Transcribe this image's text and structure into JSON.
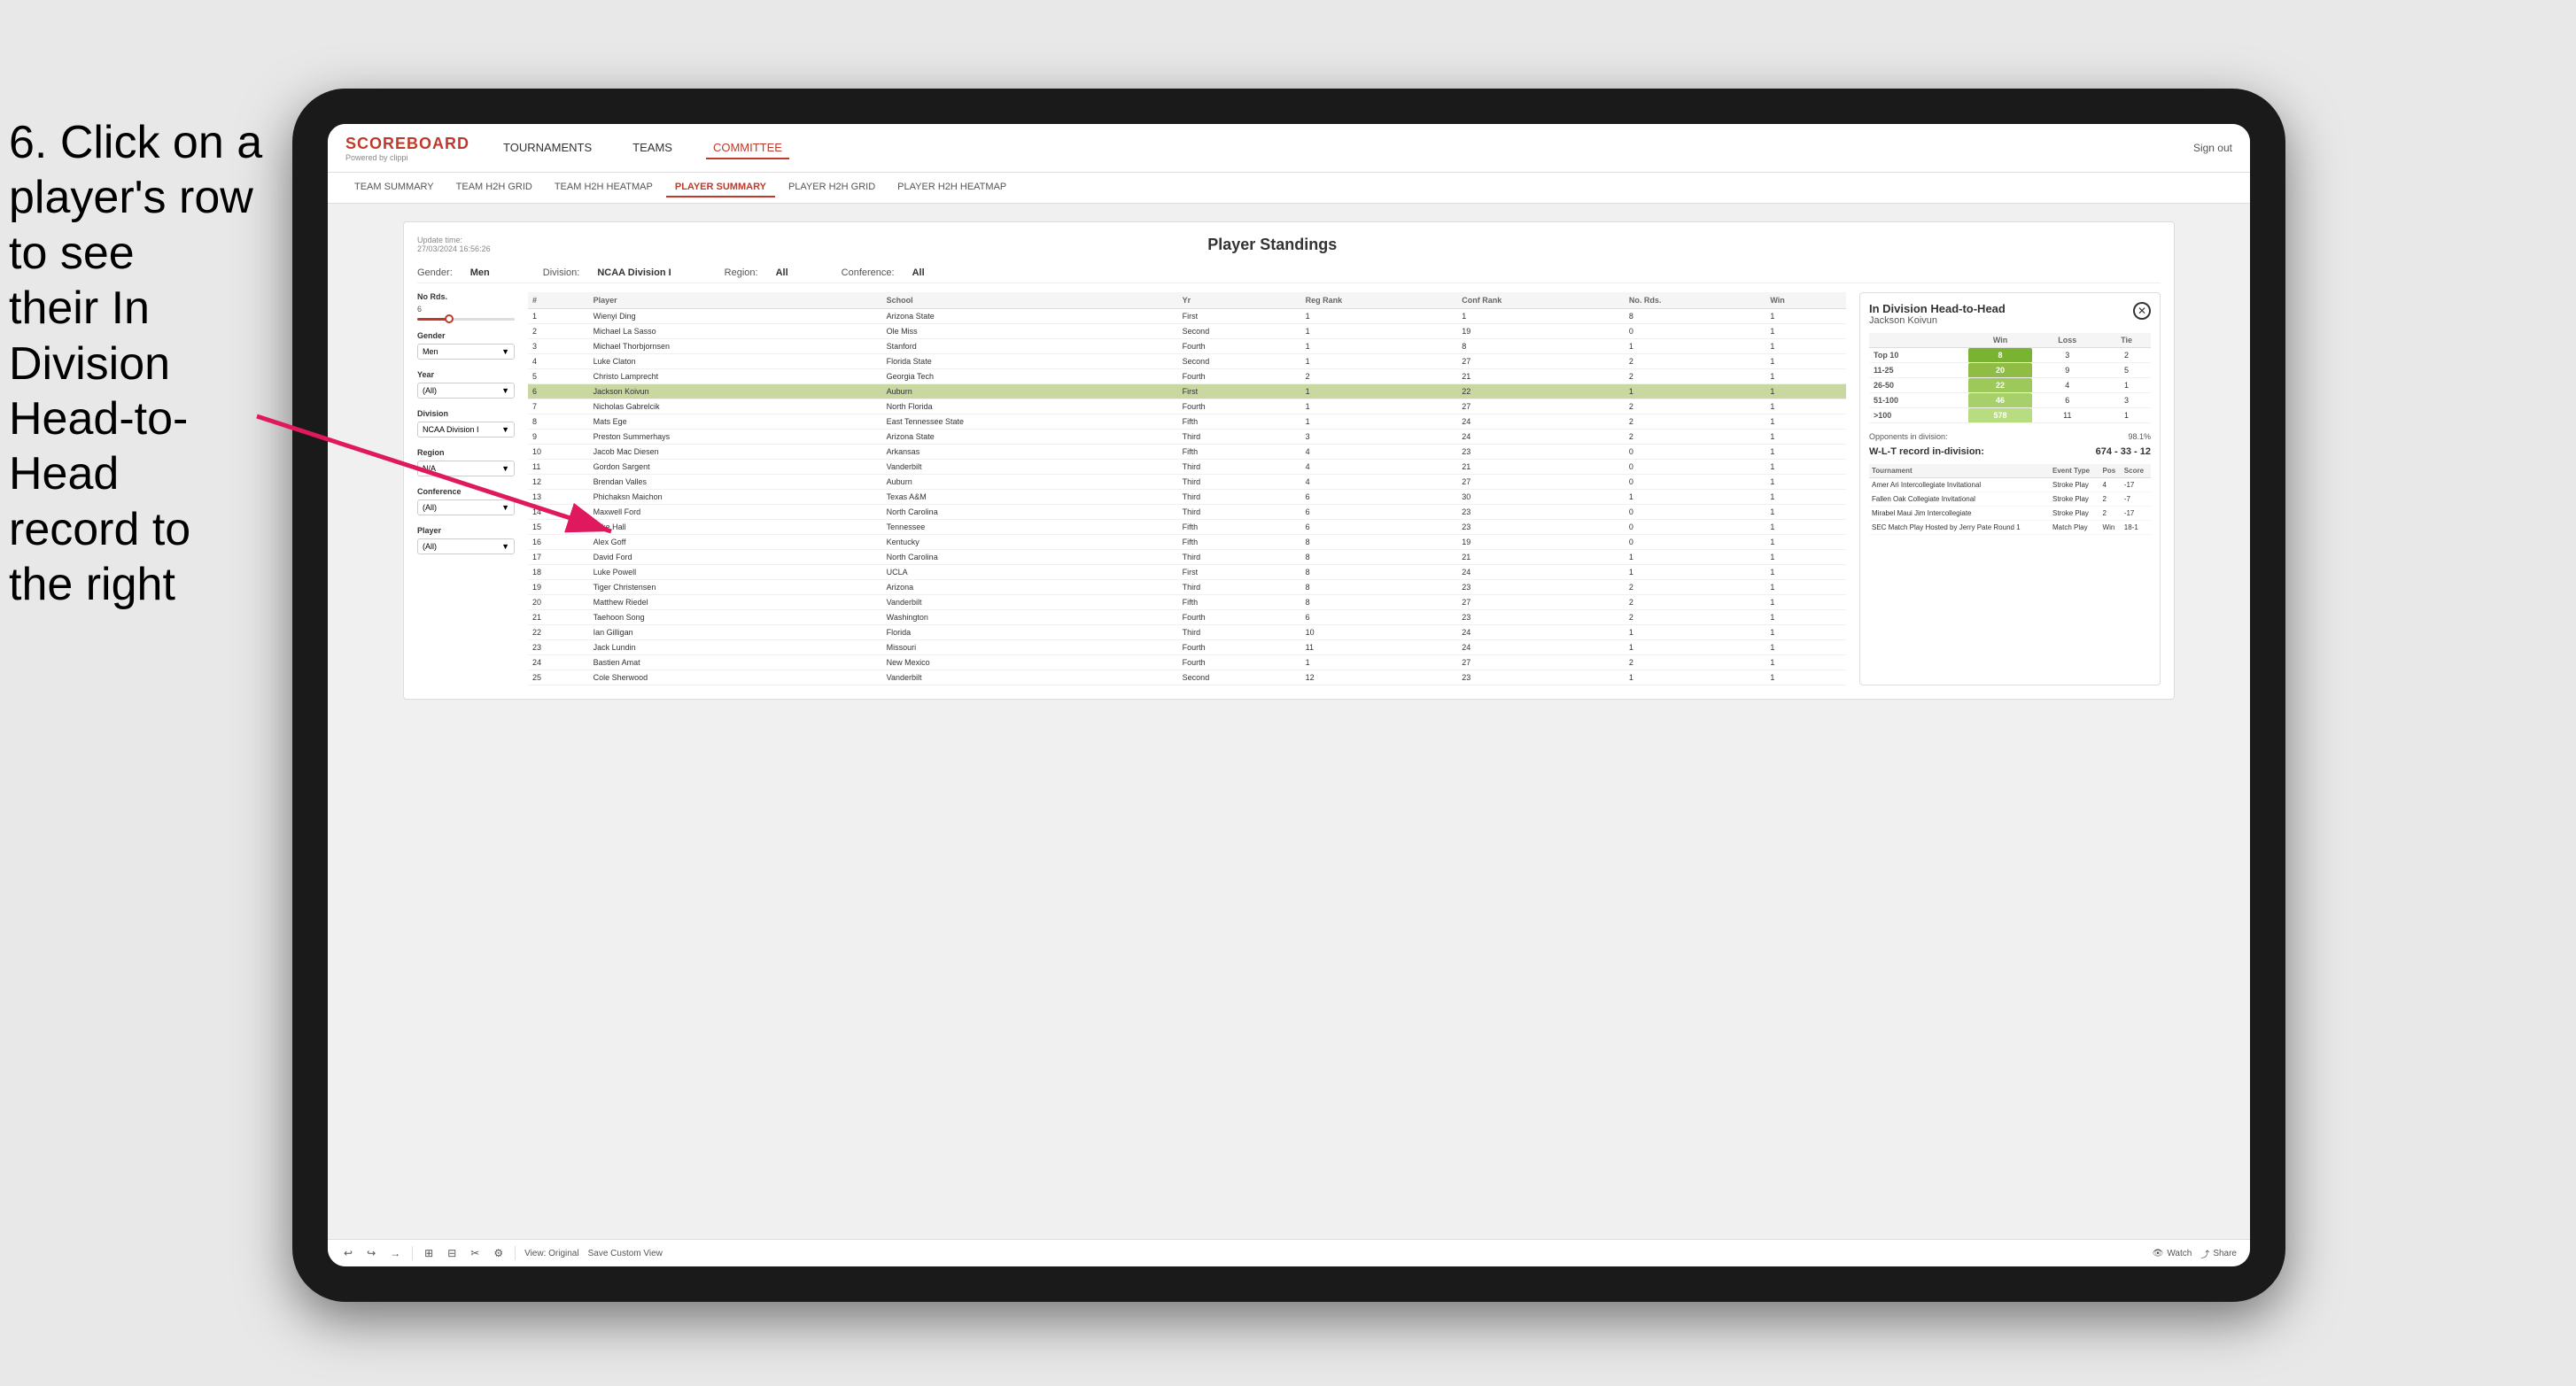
{
  "instruction": {
    "line1": "6. Click on a",
    "line2": "player's row to see",
    "line3": "their In Division",
    "line4": "Head-to-Head",
    "line5": "record to the right"
  },
  "nav": {
    "logo": "SCOREBOARD",
    "logo_sub": "Powered by clippi",
    "items": [
      "TOURNAMENTS",
      "TEAMS",
      "COMMITTEE"
    ],
    "sign_out": "Sign out"
  },
  "sub_nav": {
    "items": [
      "TEAM SUMMARY",
      "TEAM H2H GRID",
      "TEAM H2H HEATMAP",
      "PLAYER SUMMARY",
      "PLAYER H2H GRID",
      "PLAYER H2H HEATMAP"
    ]
  },
  "card": {
    "update_time": "Update time:",
    "update_date": "27/03/2024 16:56:26",
    "title": "Player Standings",
    "filters": {
      "gender_label": "Gender:",
      "gender_value": "Men",
      "division_label": "Division:",
      "division_value": "NCAA Division I",
      "region_label": "Region:",
      "region_value": "All",
      "conference_label": "Conference:",
      "conference_value": "All"
    }
  },
  "left_filters": {
    "no_rds": {
      "label": "No Rds.",
      "value": "6",
      "min_val": "6"
    },
    "gender": {
      "label": "Gender",
      "value": "Men"
    },
    "year": {
      "label": "Year",
      "value": "(All)"
    },
    "division": {
      "label": "Division",
      "value": "NCAA Division I"
    },
    "region": {
      "label": "Region",
      "value": "N/A"
    },
    "conference": {
      "label": "Conference",
      "value": "(All)"
    },
    "player": {
      "label": "Player",
      "value": "(All)"
    }
  },
  "table": {
    "headers": [
      "#",
      "Player",
      "School",
      "Yr",
      "Reg Rank",
      "Conf Rank",
      "No. Rds.",
      "Win"
    ],
    "rows": [
      {
        "num": 1,
        "player": "Wienyi Ding",
        "school": "Arizona State",
        "yr": "First",
        "reg_rank": 1,
        "conf_rank": 1,
        "no_rds": 8,
        "win": 1
      },
      {
        "num": 2,
        "player": "Michael La Sasso",
        "school": "Ole Miss",
        "yr": "Second",
        "reg_rank": 1,
        "conf_rank": 19,
        "no_rds": 0,
        "win": 1
      },
      {
        "num": 3,
        "player": "Michael Thorbjornsen",
        "school": "Stanford",
        "yr": "Fourth",
        "reg_rank": 1,
        "conf_rank": 8,
        "no_rds": 1,
        "win": 1
      },
      {
        "num": 4,
        "player": "Luke Claton",
        "school": "Florida State",
        "yr": "Second",
        "reg_rank": 1,
        "conf_rank": 27,
        "no_rds": 2,
        "win": 1
      },
      {
        "num": 5,
        "player": "Christo Lamprecht",
        "school": "Georgia Tech",
        "yr": "Fourth",
        "reg_rank": 2,
        "conf_rank": 21,
        "no_rds": 2,
        "win": 1
      },
      {
        "num": 6,
        "player": "Jackson Koivun",
        "school": "Auburn",
        "yr": "First",
        "reg_rank": 1,
        "conf_rank": 22,
        "no_rds": 1,
        "win": 1,
        "selected": true
      },
      {
        "num": 7,
        "player": "Nicholas Gabrelcik",
        "school": "North Florida",
        "yr": "Fourth",
        "reg_rank": 1,
        "conf_rank": 27,
        "no_rds": 2,
        "win": 1
      },
      {
        "num": 8,
        "player": "Mats Ege",
        "school": "East Tennessee State",
        "yr": "Fifth",
        "reg_rank": 1,
        "conf_rank": 24,
        "no_rds": 2,
        "win": 1
      },
      {
        "num": 9,
        "player": "Preston Summerhays",
        "school": "Arizona State",
        "yr": "Third",
        "reg_rank": 3,
        "conf_rank": 24,
        "no_rds": 2,
        "win": 1
      },
      {
        "num": 10,
        "player": "Jacob Mac Diesen",
        "school": "Arkansas",
        "yr": "Fifth",
        "reg_rank": 4,
        "conf_rank": 23,
        "no_rds": 0,
        "win": 1
      },
      {
        "num": 11,
        "player": "Gordon Sargent",
        "school": "Vanderbilt",
        "yr": "Third",
        "reg_rank": 4,
        "conf_rank": 21,
        "no_rds": 0,
        "win": 1
      },
      {
        "num": 12,
        "player": "Brendan Valles",
        "school": "Auburn",
        "yr": "Third",
        "reg_rank": 4,
        "conf_rank": 27,
        "no_rds": 0,
        "win": 1
      },
      {
        "num": 13,
        "player": "Phichaksn Maichon",
        "school": "Texas A&M",
        "yr": "Third",
        "reg_rank": 6,
        "conf_rank": 30,
        "no_rds": 1,
        "win": 1
      },
      {
        "num": 14,
        "player": "Maxwell Ford",
        "school": "North Carolina",
        "yr": "Third",
        "reg_rank": 6,
        "conf_rank": 23,
        "no_rds": 0,
        "win": 1
      },
      {
        "num": 15,
        "player": "Jake Hall",
        "school": "Tennessee",
        "yr": "Fifth",
        "reg_rank": 6,
        "conf_rank": 23,
        "no_rds": 0,
        "win": 1
      },
      {
        "num": 16,
        "player": "Alex Goff",
        "school": "Kentucky",
        "yr": "Fifth",
        "reg_rank": 8,
        "conf_rank": 19,
        "no_rds": 0,
        "win": 1
      },
      {
        "num": 17,
        "player": "David Ford",
        "school": "North Carolina",
        "yr": "Third",
        "reg_rank": 8,
        "conf_rank": 21,
        "no_rds": 1,
        "win": 1
      },
      {
        "num": 18,
        "player": "Luke Powell",
        "school": "UCLA",
        "yr": "First",
        "reg_rank": 8,
        "conf_rank": 24,
        "no_rds": 1,
        "win": 1
      },
      {
        "num": 19,
        "player": "Tiger Christensen",
        "school": "Arizona",
        "yr": "Third",
        "reg_rank": 8,
        "conf_rank": 23,
        "no_rds": 2,
        "win": 1
      },
      {
        "num": 20,
        "player": "Matthew Riedel",
        "school": "Vanderbilt",
        "yr": "Fifth",
        "reg_rank": 8,
        "conf_rank": 27,
        "no_rds": 2,
        "win": 1
      },
      {
        "num": 21,
        "player": "Taehoon Song",
        "school": "Washington",
        "yr": "Fourth",
        "reg_rank": 6,
        "conf_rank": 23,
        "no_rds": 2,
        "win": 1
      },
      {
        "num": 22,
        "player": "Ian Gilligan",
        "school": "Florida",
        "yr": "Third",
        "reg_rank": 10,
        "conf_rank": 24,
        "no_rds": 1,
        "win": 1
      },
      {
        "num": 23,
        "player": "Jack Lundin",
        "school": "Missouri",
        "yr": "Fourth",
        "reg_rank": 11,
        "conf_rank": 24,
        "no_rds": 1,
        "win": 1
      },
      {
        "num": 24,
        "player": "Bastien Amat",
        "school": "New Mexico",
        "yr": "Fourth",
        "reg_rank": 1,
        "conf_rank": 27,
        "no_rds": 2,
        "win": 1
      },
      {
        "num": 25,
        "player": "Cole Sherwood",
        "school": "Vanderbilt",
        "yr": "Second",
        "reg_rank": 12,
        "conf_rank": 23,
        "no_rds": 1,
        "win": 1
      }
    ]
  },
  "h2h": {
    "title": "In Division Head-to-Head",
    "player_name": "Jackson Koivun",
    "rank_groups": [
      {
        "group": "Top 10",
        "win": 8,
        "loss": 3,
        "tie": 2
      },
      {
        "group": "11-25",
        "win": 20,
        "loss": 9,
        "tie": 5
      },
      {
        "group": "26-50",
        "win": 22,
        "loss": 4,
        "tie": 1
      },
      {
        "group": "51-100",
        "win": 46,
        "loss": 6,
        "tie": 3
      },
      {
        "group": ">100",
        "win": 578,
        "loss": 11,
        "tie": 1
      }
    ],
    "opponents_label": "Opponents in division:",
    "opponents_value": "98.1%",
    "wlt_label": "W-L-T record in-division:",
    "wlt_value": "674 - 33 - 12",
    "tournaments_headers": [
      "Tournament",
      "Event Type",
      "Pos",
      "Score"
    ],
    "tournaments": [
      {
        "name": "Amer Ari Intercollegiate Invitational",
        "type": "Stroke Play",
        "pos": 4,
        "score": -17
      },
      {
        "name": "Fallen Oak Collegiate Invitational",
        "type": "Stroke Play",
        "pos": 2,
        "score": -7
      },
      {
        "name": "Mirabel Maui Jim Intercollegiate",
        "type": "Stroke Play",
        "pos": 2,
        "score": -17
      },
      {
        "name": "SEC Match Play Hosted by Jerry Pate Round 1",
        "type": "Match Play",
        "pos": "Win",
        "score": "18-1"
      }
    ]
  },
  "toolbar": {
    "undo": "↩",
    "redo": "↪",
    "forward": "→",
    "view_original": "View: Original",
    "save_custom_view": "Save Custom View",
    "watch": "Watch",
    "share": "Share"
  }
}
